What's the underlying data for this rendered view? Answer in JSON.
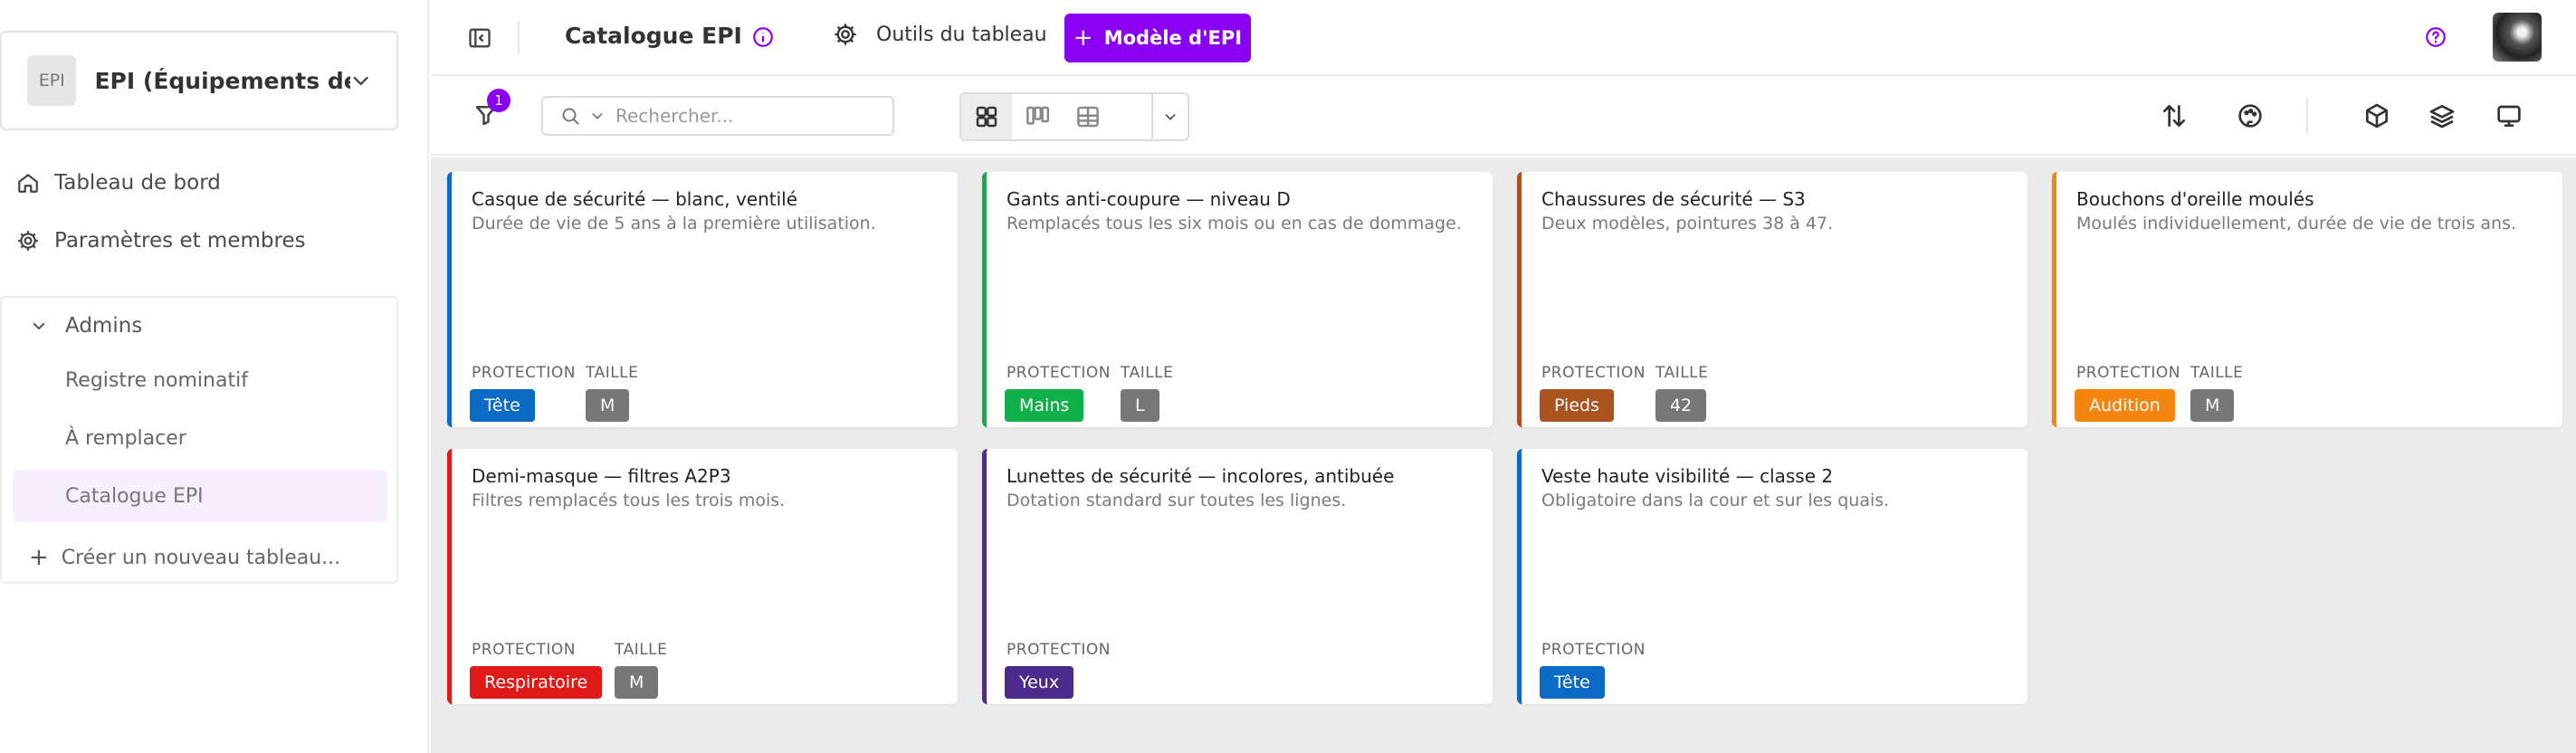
{
  "sidebar": {
    "workspace": {
      "initials": "EPI",
      "name": "EPI (Équipements de ..."
    },
    "nav": [
      {
        "label": "Tableau de bord"
      },
      {
        "label": "Paramètres et membres"
      }
    ],
    "group": {
      "title": "Admins",
      "items": [
        {
          "label": "Registre nominatif"
        },
        {
          "label": "À remplacer"
        },
        {
          "label": "Catalogue EPI",
          "active": true
        }
      ],
      "create_label": "Créer un nouveau tableau..."
    }
  },
  "topbar": {
    "title": "Catalogue EPI",
    "tools_label": "Outils du tableau",
    "primary_label": "Modèle d'EPI"
  },
  "toolbar": {
    "filter_count": "1",
    "search_placeholder": "Rechercher..."
  },
  "colors": {
    "accent": "#8a00f0",
    "tete": "#0a6ac4",
    "mains": "#0fb049",
    "pieds": "#a9531e",
    "audition": "#f5850f",
    "respiratoire": "#e01919",
    "yeux": "#4b2b8c",
    "size_tag": "#777777"
  },
  "cards": [
    {
      "title": "Casque de sécurité — blanc, ventilé",
      "desc": "Durée de vie de 5 ans à la première utilisation.",
      "protection_label": "PROTECTION",
      "size_label": "TAILLE",
      "protection": "Tête",
      "color": "#0a6ac4",
      "size": "M"
    },
    {
      "title": "Gants anti-coupure — niveau D",
      "desc": "Remplacés tous les six mois ou en cas de dommage.",
      "protection_label": "PROTECTION",
      "size_label": "TAILLE",
      "protection": "Mains",
      "color": "#0fb049",
      "size": "L"
    },
    {
      "title": "Chaussures de sécurité — S3",
      "desc": "Deux modèles, pointures 38 à 47.",
      "protection_label": "PROTECTION",
      "size_label": "TAILLE",
      "protection": "Pieds",
      "color": "#a9531e",
      "size": "42"
    },
    {
      "title": "Bouchons d'oreille moulés",
      "desc": "Moulés individuellement, durée de vie de trois ans.",
      "protection_label": "PROTECTION",
      "size_label": "TAILLE",
      "protection": "Audition",
      "color": "#f5850f",
      "size": "M"
    },
    {
      "title": "Demi-masque — filtres A2P3",
      "desc": "Filtres remplacés tous les trois mois.",
      "protection_label": "PROTECTION",
      "size_label": "TAILLE",
      "protection": "Respiratoire",
      "color": "#e01919",
      "size": "M"
    },
    {
      "title": "Lunettes de sécurité — incolores, antibuée",
      "desc": "Dotation standard sur toutes les lignes.",
      "protection_label": "PROTECTION",
      "protection": "Yeux",
      "color": "#4b2b8c"
    },
    {
      "title": "Veste haute visibilité — classe 2",
      "desc": "Obligatoire dans la cour et sur les quais.",
      "protection_label": "PROTECTION",
      "protection": "Tête",
      "color": "#0a6ac4"
    }
  ]
}
